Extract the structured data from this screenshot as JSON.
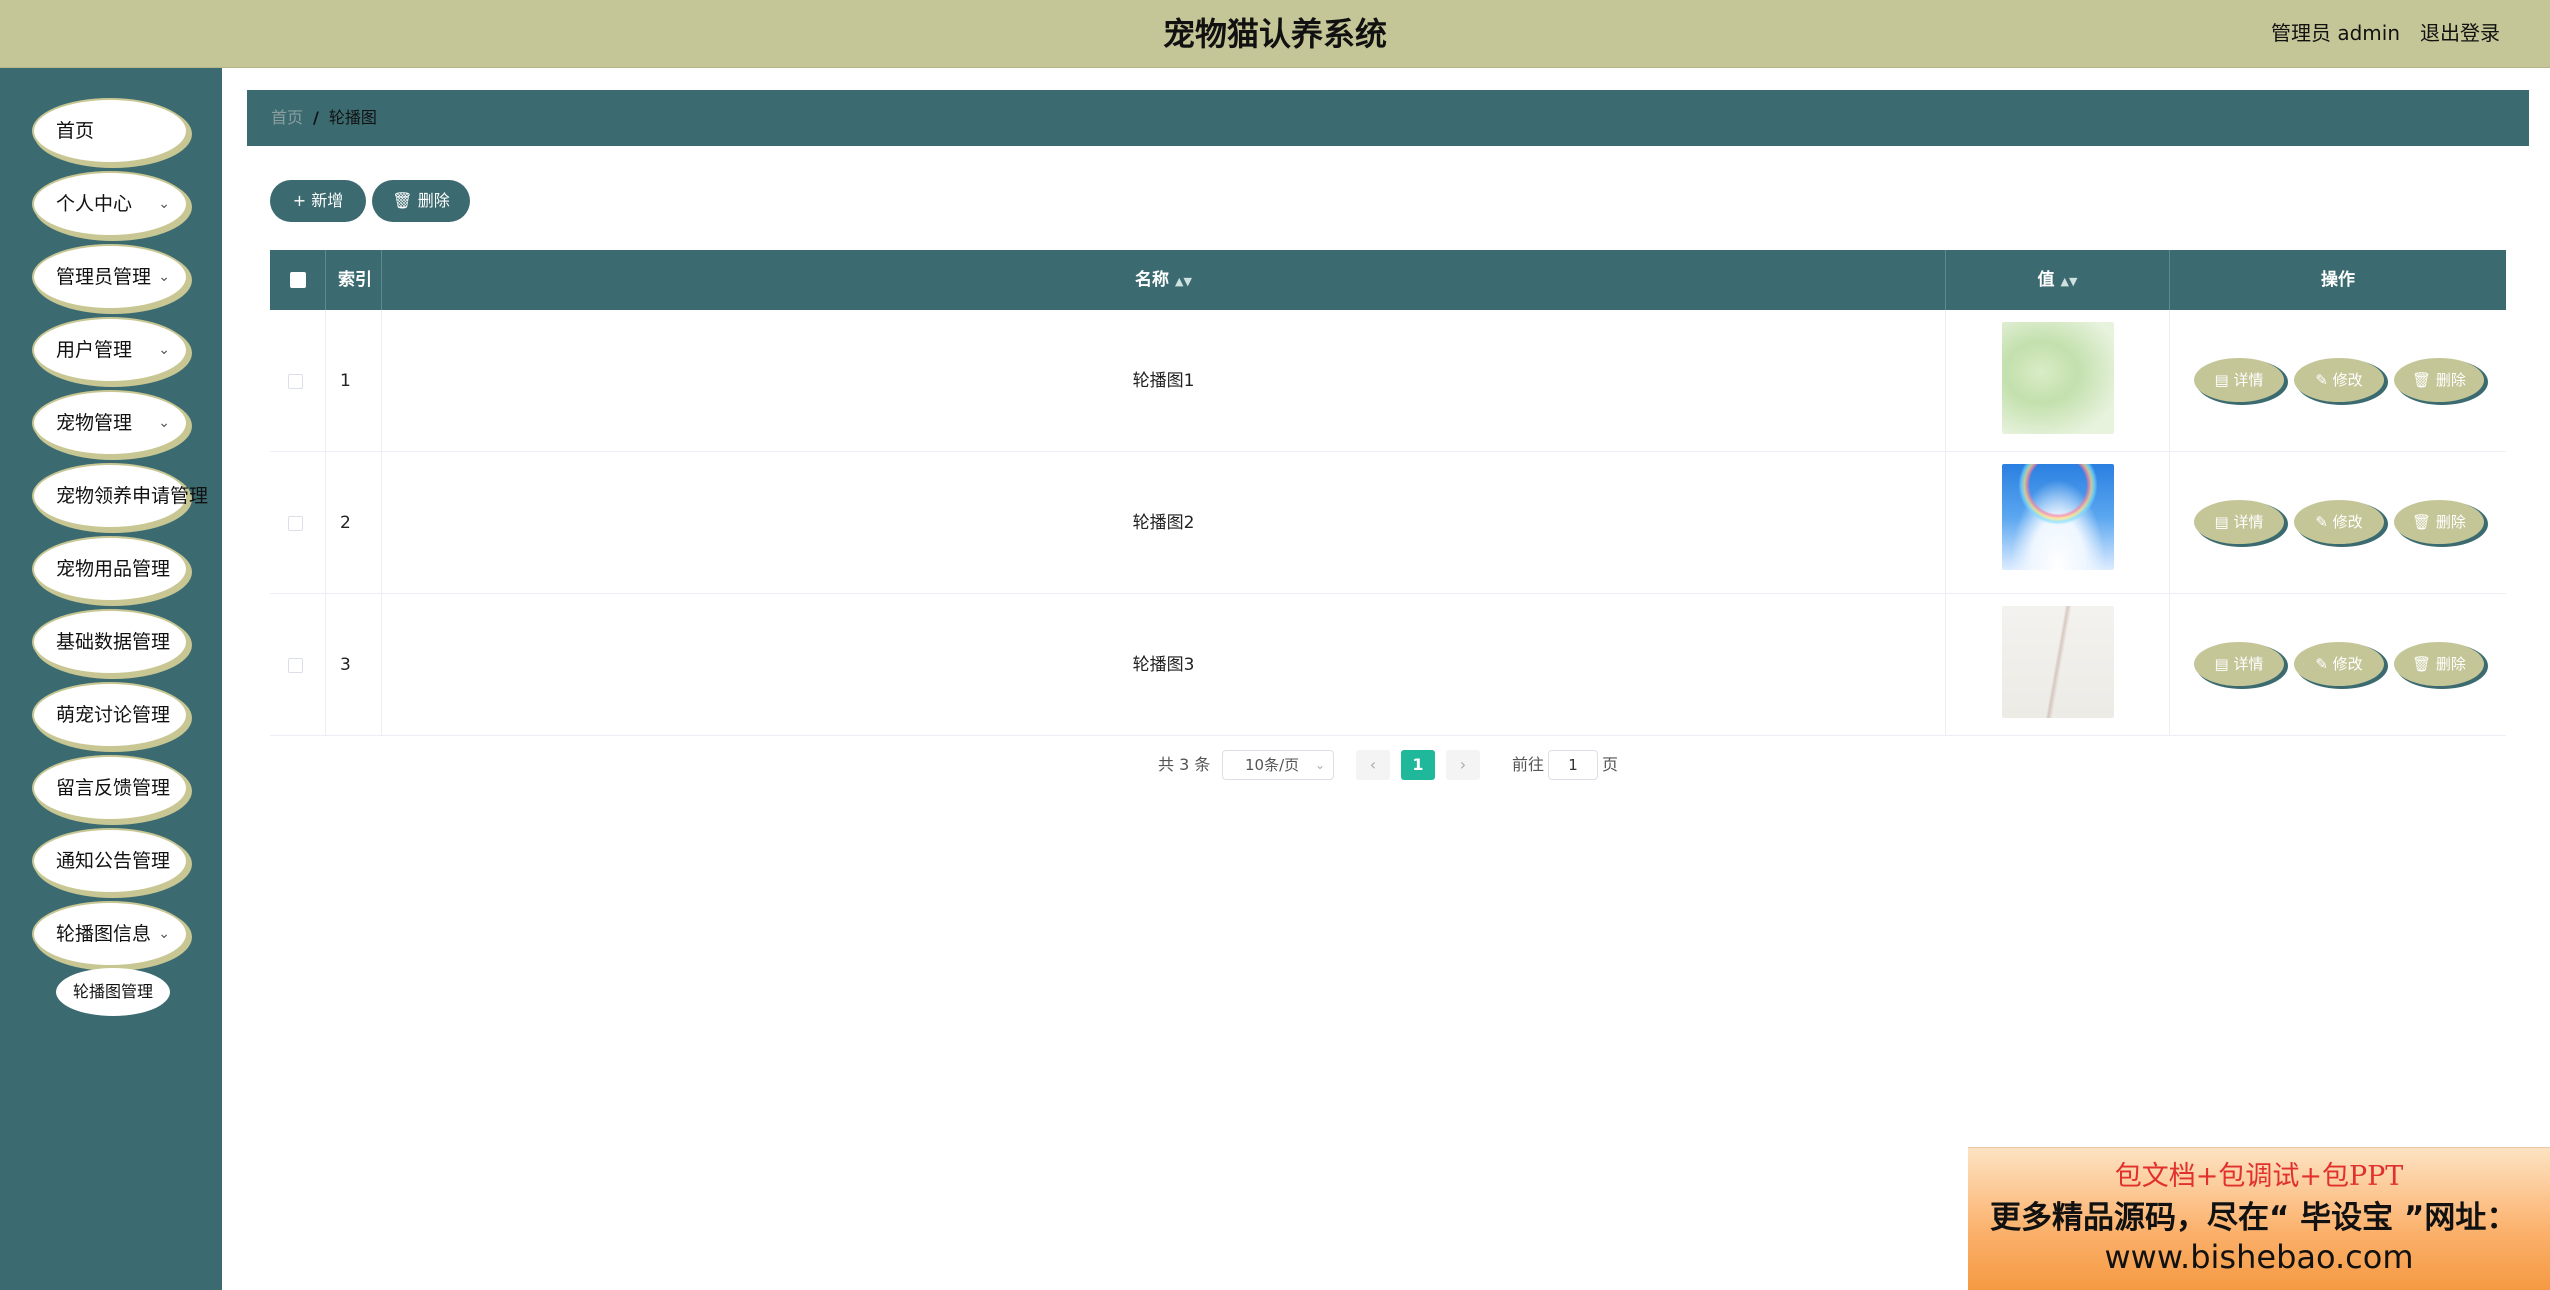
{
  "header": {
    "title": "宠物猫认养系统",
    "user": "管理员 admin",
    "logout": "退出登录"
  },
  "sidebar": {
    "items": [
      {
        "label": "首页",
        "has_chevron": false
      },
      {
        "label": "个人中心",
        "has_chevron": true
      },
      {
        "label": "管理员管理",
        "has_chevron": true
      },
      {
        "label": "用户管理",
        "has_chevron": true
      },
      {
        "label": "宠物管理",
        "has_chevron": true
      },
      {
        "label": "宠物领养申请管理",
        "has_chevron": false
      },
      {
        "label": "宠物用品管理",
        "has_chevron": false
      },
      {
        "label": "基础数据管理",
        "has_chevron": false
      },
      {
        "label": "萌宠讨论管理",
        "has_chevron": false
      },
      {
        "label": "留言反馈管理",
        "has_chevron": false
      },
      {
        "label": "通知公告管理",
        "has_chevron": false
      },
      {
        "label": "轮播图信息",
        "has_chevron": true
      }
    ],
    "subitem": "轮播图管理"
  },
  "breadcrumb": {
    "home": "首页",
    "current": "轮播图"
  },
  "toolbar": {
    "add": "+ 新增",
    "delete": "删除"
  },
  "table": {
    "columns": {
      "index": "索引",
      "name": "名称",
      "value": "值",
      "actions": "操作"
    },
    "rows": [
      {
        "index": "1",
        "name": "轮播图1",
        "image": "green-meadow"
      },
      {
        "index": "2",
        "name": "轮播图2",
        "image": "sky-rainbow"
      },
      {
        "index": "3",
        "name": "轮播图3",
        "image": "pale-tower"
      }
    ],
    "actions": {
      "detail": "详情",
      "edit": "修改",
      "delete": "删除"
    }
  },
  "pagination": {
    "total": "共 3 条",
    "page_size": "10条/页",
    "current_page": "1",
    "goto_label": "前往",
    "goto_value": "1",
    "page_suffix": "页"
  },
  "promo": {
    "line1": "包文档+包调试+包PPT",
    "line2": "更多精品源码，尽在“ 毕设宝 ”网址：",
    "line3": "www.bishebao.com"
  },
  "colors": {
    "teal": "#3b6b70",
    "olive": "#c5c698",
    "active_page": "#1fb89b"
  }
}
